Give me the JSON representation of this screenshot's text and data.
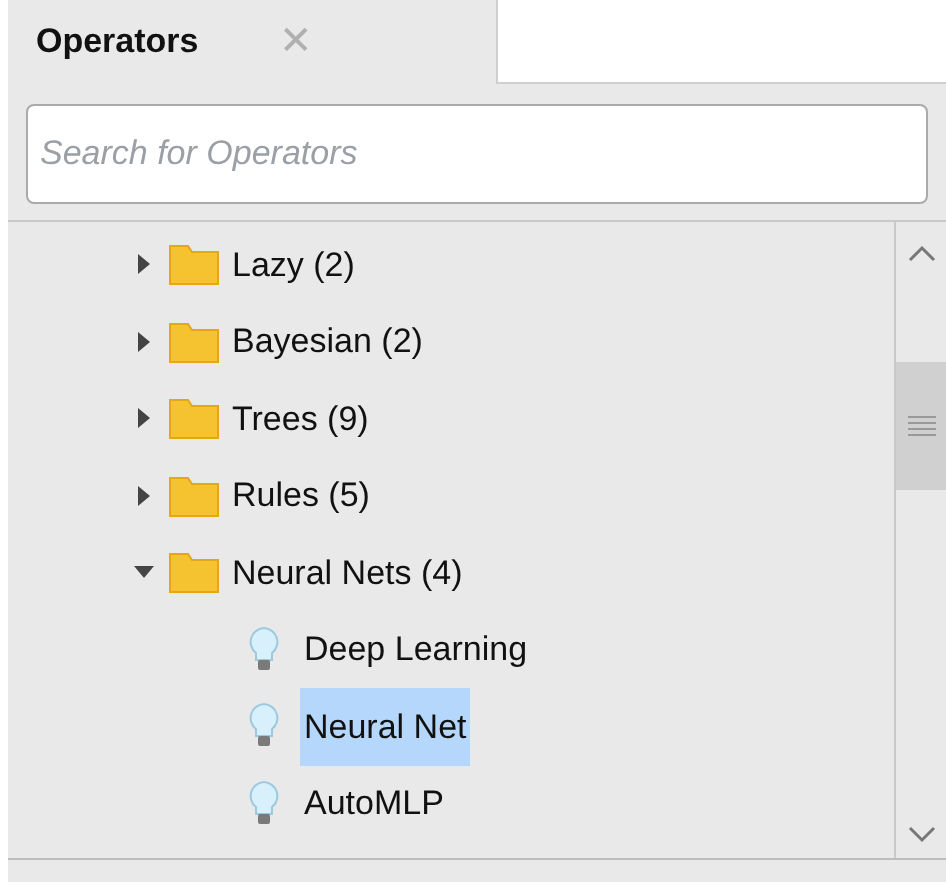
{
  "tab": {
    "label": "Operators",
    "selected": true,
    "close": "✕"
  },
  "search": {
    "placeholder": "Search for Operators"
  },
  "tree": [
    {
      "label": "Lazy (2)",
      "expanded": false
    },
    {
      "label": "Bayesian (2)",
      "expanded": false
    },
    {
      "label": "Trees (9)",
      "expanded": false
    },
    {
      "label": "Rules (5)",
      "expanded": false
    },
    {
      "label": "Neural Nets (4)",
      "expanded": true,
      "children": [
        {
          "label": "Deep Learning",
          "selected": false
        },
        {
          "label": "Neural Net",
          "selected": true
        },
        {
          "label": "AutoMLP",
          "selected": false
        }
      ]
    }
  ]
}
